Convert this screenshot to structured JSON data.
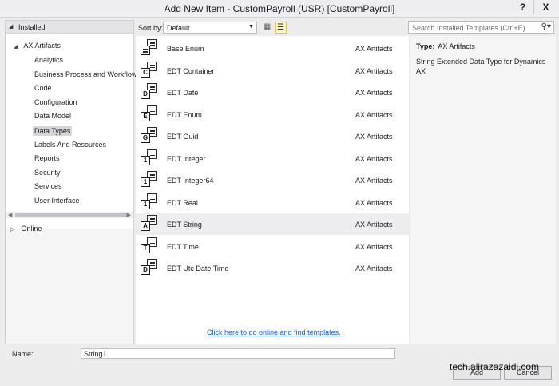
{
  "window": {
    "title": "Add New Item - CustomPayroll (USR) [CustomPayroll]",
    "help_label": "?",
    "close_label": "X"
  },
  "left": {
    "installed_label": "Installed",
    "root_label": "AX Artifacts",
    "items": [
      "Analytics",
      "Business Process and Workflow",
      "Code",
      "Configuration",
      "Data Model",
      "Data Types",
      "Labels And Resources",
      "Reports",
      "Security",
      "Services",
      "User Interface"
    ],
    "selected": "Data Types",
    "online_label": "Online"
  },
  "toolbar": {
    "sort_label": "Sort by:",
    "sort_value": "Default"
  },
  "search": {
    "placeholder": "Search Installed Templates (Ctrl+E)"
  },
  "templates": [
    {
      "name": "Base Enum",
      "category": "AX Artifacts",
      "icon": "base-enum-icon",
      "letter": ""
    },
    {
      "name": "EDT Container",
      "category": "AX Artifacts",
      "icon": "edt-container-icon",
      "letter": "C"
    },
    {
      "name": "EDT Date",
      "category": "AX Artifacts",
      "icon": "edt-date-icon",
      "letter": "D"
    },
    {
      "name": "EDT Enum",
      "category": "AX Artifacts",
      "icon": "edt-enum-icon",
      "letter": "E"
    },
    {
      "name": "EDT Guid",
      "category": "AX Artifacts",
      "icon": "edt-guid-icon",
      "letter": "G"
    },
    {
      "name": "EDT Integer",
      "category": "AX Artifacts",
      "icon": "edt-integer-icon",
      "letter": "1"
    },
    {
      "name": "EDT Integer64",
      "category": "AX Artifacts",
      "icon": "edt-integer64-icon",
      "letter": "1"
    },
    {
      "name": "EDT Real",
      "category": "AX Artifacts",
      "icon": "edt-real-icon",
      "letter": "1"
    },
    {
      "name": "EDT String",
      "category": "AX Artifacts",
      "icon": "edt-string-icon",
      "letter": "A"
    },
    {
      "name": "EDT Time",
      "category": "AX Artifacts",
      "icon": "edt-time-icon",
      "letter": "T"
    },
    {
      "name": "EDT Utc Date Time",
      "category": "AX Artifacts",
      "icon": "edt-utc-date-time-icon",
      "letter": "D"
    }
  ],
  "selected_template": "EDT String",
  "online_link": "Click here to go online and find templates.",
  "details": {
    "type_label": "Type:",
    "type_value": "AX Artifacts",
    "description": "String Extended Data Type for Dynamics AX"
  },
  "footer": {
    "name_label": "Name:",
    "name_value": "String1",
    "add_label": "Add",
    "cancel_label": "Cancel"
  },
  "watermark": "tech.alirazazaidi.com",
  "colors": {
    "link": "#1a5cd8",
    "selection": "#ededef",
    "accent_view": "#fff7c8"
  }
}
